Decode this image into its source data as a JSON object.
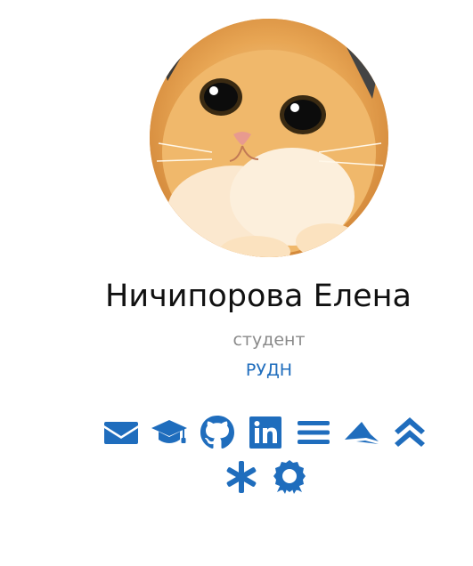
{
  "profile": {
    "name": "Ничипорова Елена",
    "role": "студент",
    "organization": "РУДН"
  },
  "avatar": {
    "subject": "orange kitten photo"
  },
  "social_icons": [
    [
      "envelope-icon",
      "graduation-cap-icon",
      "github-icon",
      "linkedin-icon",
      "list-icon",
      "paper-plane-icon",
      "double-chevron-up-icon"
    ],
    [
      "asterisk-icon",
      "award-icon"
    ]
  ],
  "colors": {
    "accent": "#1f6dbd",
    "role_text": "#8a8a8a",
    "name_text": "#111111"
  }
}
